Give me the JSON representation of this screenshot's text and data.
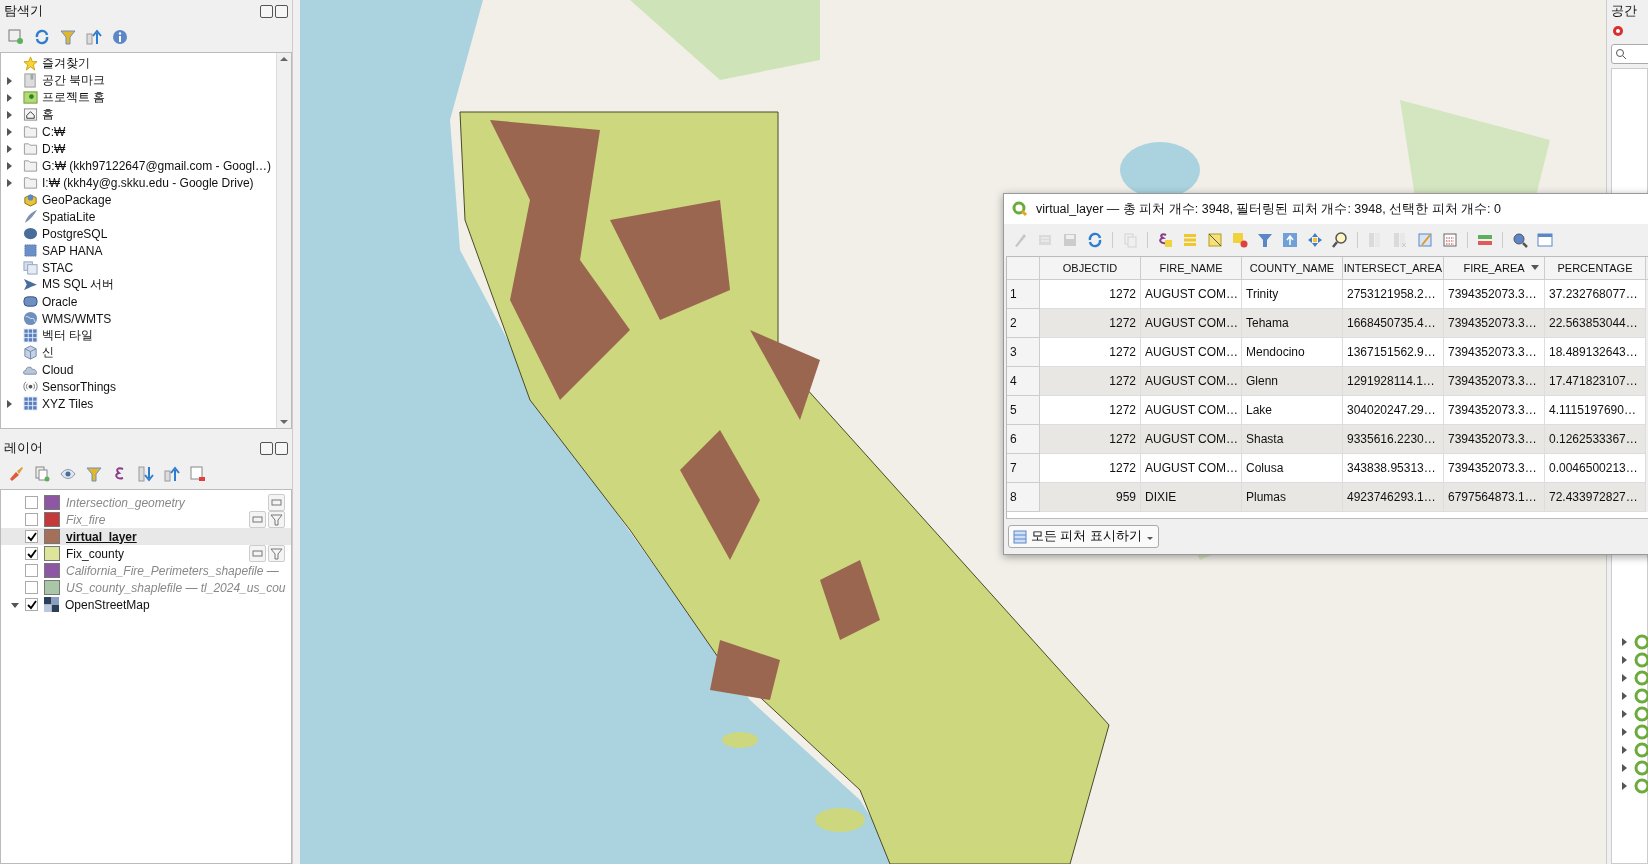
{
  "browser_panel": {
    "title": "탐색기",
    "items": [
      {
        "label": "즐겨찾기",
        "expandable": false
      },
      {
        "label": "공간 북마크",
        "expandable": true
      },
      {
        "label": "프로젝트 홈",
        "expandable": true
      },
      {
        "label": "홈",
        "expandable": true
      },
      {
        "label": "C:₩",
        "expandable": true
      },
      {
        "label": "D:₩",
        "expandable": true
      },
      {
        "label": "G:₩ (kkh97122647@gmail.com - Googl…)",
        "expandable": true
      },
      {
        "label": "I:₩ (kkh4y@g.skku.edu - Google Drive)",
        "expandable": true
      },
      {
        "label": "GeoPackage",
        "expandable": false
      },
      {
        "label": "SpatiaLite",
        "expandable": false
      },
      {
        "label": "PostgreSQL",
        "expandable": false
      },
      {
        "label": "SAP HANA",
        "expandable": false
      },
      {
        "label": "STAC",
        "expandable": false
      },
      {
        "label": "MS SQL 서버",
        "expandable": false
      },
      {
        "label": "Oracle",
        "expandable": false
      },
      {
        "label": "WMS/WMTS",
        "expandable": false
      },
      {
        "label": "벡터 타일",
        "expandable": false
      },
      {
        "label": "신",
        "expandable": false
      },
      {
        "label": "Cloud",
        "expandable": false
      },
      {
        "label": "SensorThings",
        "expandable": false
      },
      {
        "label": "XYZ Tiles",
        "expandable": true
      }
    ]
  },
  "layers_panel": {
    "title": "레이어",
    "layers": [
      {
        "name": "Intersection_geometry",
        "kind": "vector",
        "checked": false,
        "selected": false,
        "color": "#8e57a4",
        "temporary": true,
        "filtered": false
      },
      {
        "name": "Fix_fire",
        "kind": "vector",
        "checked": false,
        "selected": false,
        "color": "#c43a3a",
        "temporary": true,
        "filtered": true
      },
      {
        "name": "virtual_layer",
        "kind": "vector",
        "checked": true,
        "selected": true,
        "color": "#a5705a",
        "temporary": false,
        "filtered": false
      },
      {
        "name": "Fix_county",
        "kind": "vector",
        "checked": true,
        "selected": false,
        "color": "#dde59a",
        "temporary": true,
        "filtered": true
      },
      {
        "name": "California_Fire_Perimeters_shapefile —",
        "kind": "vector",
        "checked": false,
        "selected": false,
        "color": "#8e57a4",
        "temporary": false,
        "filtered": false
      },
      {
        "name": "US_county_shaplefile — tl_2024_us_cou",
        "kind": "vector",
        "checked": false,
        "selected": false,
        "color": "#a9c7a6",
        "temporary": false,
        "filtered": false
      },
      {
        "name": "OpenStreetMap",
        "kind": "raster",
        "checked": true,
        "selected": false,
        "expanded": true
      }
    ]
  },
  "attribute_table": {
    "title": "virtual_layer — 총 피처 개수: 3948, 필터링된 피처 개수: 3948, 선택한 피처 개수: 0",
    "toolbar": [
      {
        "disabled": true
      },
      {
        "disabled": true
      },
      {
        "disabled": true
      },
      {
        "disabled": false
      },
      {
        "disabled": true
      },
      {
        "disabled": false
      },
      {
        "disabled": false
      },
      {
        "disabled": false
      },
      {
        "disabled": false
      },
      {
        "disabled": false
      },
      {
        "disabled": false
      },
      {
        "disabled": false
      },
      {
        "disabled": false
      },
      {
        "disabled": true
      },
      {
        "disabled": true
      },
      {
        "disabled": false
      },
      {
        "disabled": false
      },
      {
        "disabled": false
      },
      {
        "disabled": false
      },
      {
        "disabled": false
      }
    ],
    "columns": [
      {
        "label": "OBJECTID",
        "sorted": false
      },
      {
        "label": "FIRE_NAME",
        "sorted": false
      },
      {
        "label": "COUNTY_NAME",
        "sorted": false
      },
      {
        "label": "INTERSECT_AREA",
        "sorted": false
      },
      {
        "label": "FIRE_AREA",
        "sorted": true
      },
      {
        "label": "PERCENTAGE",
        "sorted": false
      }
    ],
    "rows": [
      {
        "index": "1",
        "cells": [
          "1272",
          "AUGUST COM…",
          "Trinity",
          "2753121958.2…",
          "7394352073.3…",
          "37.232768077…"
        ]
      },
      {
        "index": "2",
        "cells": [
          "1272",
          "AUGUST COM…",
          "Tehama",
          "1668450735.4…",
          "7394352073.3…",
          "22.563853044…"
        ]
      },
      {
        "index": "3",
        "cells": [
          "1272",
          "AUGUST COM…",
          "Mendocino",
          "1367151562.9…",
          "7394352073.3…",
          "18.489132643…"
        ]
      },
      {
        "index": "4",
        "cells": [
          "1272",
          "AUGUST COM…",
          "Glenn",
          "1291928114.1…",
          "7394352073.3…",
          "17.471823107…"
        ]
      },
      {
        "index": "5",
        "cells": [
          "1272",
          "AUGUST COM…",
          "Lake",
          "304020247.29…",
          "7394352073.3…",
          "4.1115197690…"
        ]
      },
      {
        "index": "6",
        "cells": [
          "1272",
          "AUGUST COM…",
          "Shasta",
          "9335616.2230…",
          "7394352073.3…",
          "0.1262533367…"
        ]
      },
      {
        "index": "7",
        "cells": [
          "1272",
          "AUGUST COM…",
          "Colusa",
          "343838.95313…",
          "7394352073.3…",
          "0.0046500213…"
        ]
      },
      {
        "index": "8",
        "cells": [
          "959",
          "DIXIE",
          "Plumas",
          "4923746293.1…",
          "6797564873.1…",
          "72.433972827…"
        ]
      }
    ],
    "filter_button": "모든 피처 표시하기"
  },
  "processing_panel": {
    "title": "공간"
  }
}
